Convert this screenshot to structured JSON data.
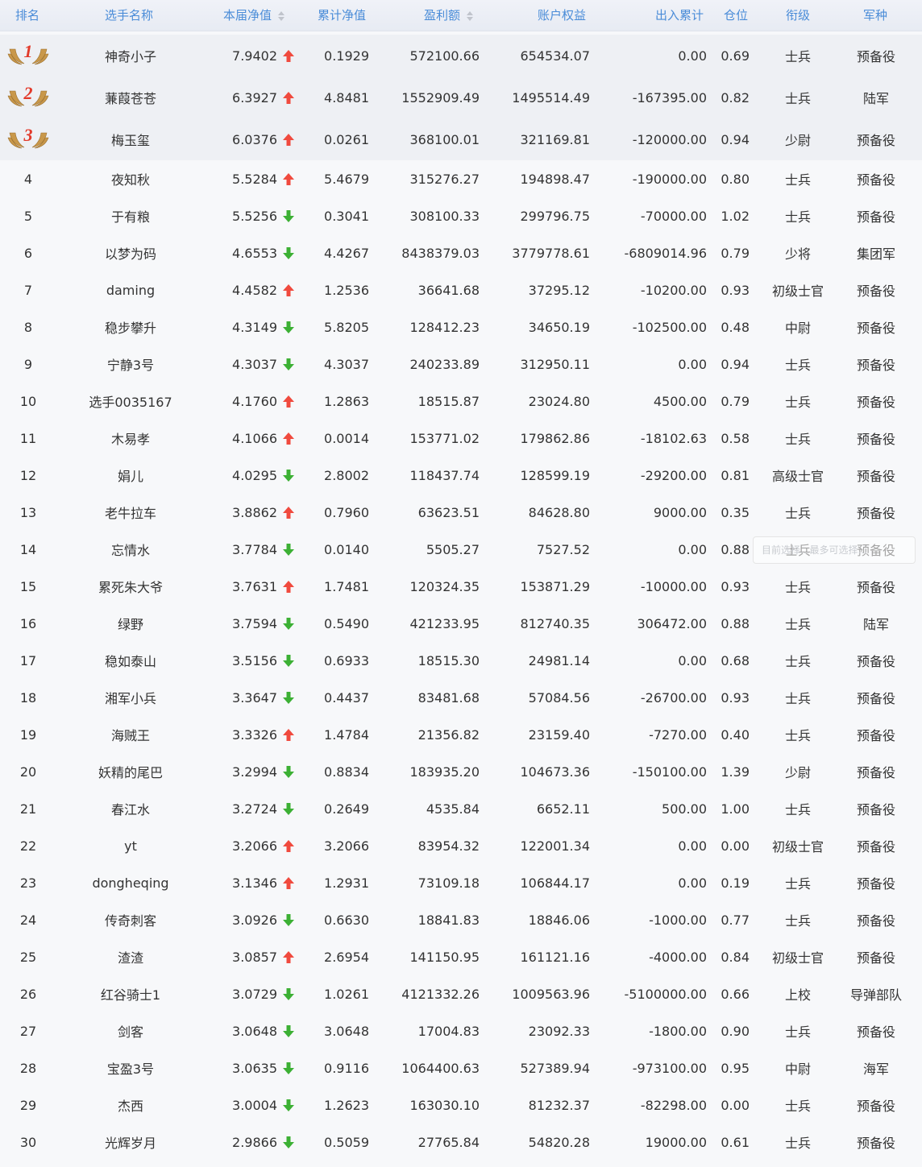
{
  "header": {
    "rank": "排名",
    "name": "选手名称",
    "nav": "本届净值",
    "cum_nav": "累计净值",
    "profit": "盈利额",
    "equity": "账户权益",
    "flow": "出入累计",
    "position": "仓位",
    "title": "衔级",
    "branch": "军种"
  },
  "colors": {
    "up": "#f04a3e",
    "down": "#3cb034",
    "header_text": "#4a8cd8"
  },
  "tooltip_text": "目前选择...最多可选择...",
  "rows": [
    {
      "rank": "1",
      "name": "神奇小子",
      "nav": "7.9402",
      "trend": "up",
      "cum": "0.1929",
      "profit": "572100.66",
      "equity": "654534.07",
      "flow": "0.00",
      "pos": "0.69",
      "title": "士兵",
      "branch": "预备役"
    },
    {
      "rank": "2",
      "name": "蒹葭苍苍",
      "nav": "6.3927",
      "trend": "up",
      "cum": "4.8481",
      "profit": "1552909.49",
      "equity": "1495514.49",
      "flow": "-167395.00",
      "pos": "0.82",
      "title": "士兵",
      "branch": "陆军"
    },
    {
      "rank": "3",
      "name": "梅玉玺",
      "nav": "6.0376",
      "trend": "up",
      "cum": "0.0261",
      "profit": "368100.01",
      "equity": "321169.81",
      "flow": "-120000.00",
      "pos": "0.94",
      "title": "少尉",
      "branch": "预备役"
    },
    {
      "rank": "4",
      "name": "夜知秋",
      "nav": "5.5284",
      "trend": "up",
      "cum": "5.4679",
      "profit": "315276.27",
      "equity": "194898.47",
      "flow": "-190000.00",
      "pos": "0.80",
      "title": "士兵",
      "branch": "预备役"
    },
    {
      "rank": "5",
      "name": "于有粮",
      "nav": "5.5256",
      "trend": "down",
      "cum": "0.3041",
      "profit": "308100.33",
      "equity": "299796.75",
      "flow": "-70000.00",
      "pos": "1.02",
      "title": "士兵",
      "branch": "预备役"
    },
    {
      "rank": "6",
      "name": "以梦为码",
      "nav": "4.6553",
      "trend": "down",
      "cum": "4.4267",
      "profit": "8438379.03",
      "equity": "3779778.61",
      "flow": "-6809014.96",
      "pos": "0.79",
      "title": "少将",
      "branch": "集团军"
    },
    {
      "rank": "7",
      "name": "daming",
      "nav": "4.4582",
      "trend": "up",
      "cum": "1.2536",
      "profit": "36641.68",
      "equity": "37295.12",
      "flow": "-10200.00",
      "pos": "0.93",
      "title": "初级士官",
      "branch": "预备役"
    },
    {
      "rank": "8",
      "name": "稳步攀升",
      "nav": "4.3149",
      "trend": "down",
      "cum": "5.8205",
      "profit": "128412.23",
      "equity": "34650.19",
      "flow": "-102500.00",
      "pos": "0.48",
      "title": "中尉",
      "branch": "预备役"
    },
    {
      "rank": "9",
      "name": "宁静3号",
      "nav": "4.3037",
      "trend": "down",
      "cum": "4.3037",
      "profit": "240233.89",
      "equity": "312950.11",
      "flow": "0.00",
      "pos": "0.94",
      "title": "士兵",
      "branch": "预备役"
    },
    {
      "rank": "10",
      "name": "选手0035167",
      "nav": "4.1760",
      "trend": "up",
      "cum": "1.2863",
      "profit": "18515.87",
      "equity": "23024.80",
      "flow": "4500.00",
      "pos": "0.79",
      "title": "士兵",
      "branch": "预备役"
    },
    {
      "rank": "11",
      "name": "木易孝",
      "nav": "4.1066",
      "trend": "up",
      "cum": "0.0014",
      "profit": "153771.02",
      "equity": "179862.86",
      "flow": "-18102.63",
      "pos": "0.58",
      "title": "士兵",
      "branch": "预备役"
    },
    {
      "rank": "12",
      "name": "娟儿",
      "nav": "4.0295",
      "trend": "down",
      "cum": "2.8002",
      "profit": "118437.74",
      "equity": "128599.19",
      "flow": "-29200.00",
      "pos": "0.81",
      "title": "高级士官",
      "branch": "预备役"
    },
    {
      "rank": "13",
      "name": "老牛拉车",
      "nav": "3.8862",
      "trend": "up",
      "cum": "0.7960",
      "profit": "63623.51",
      "equity": "84628.80",
      "flow": "9000.00",
      "pos": "0.35",
      "title": "士兵",
      "branch": "预备役"
    },
    {
      "rank": "14",
      "name": "忘情水",
      "nav": "3.7784",
      "trend": "down",
      "cum": "0.0140",
      "profit": "5505.27",
      "equity": "7527.52",
      "flow": "0.00",
      "pos": "0.88",
      "title": "士兵",
      "branch": "预备役"
    },
    {
      "rank": "15",
      "name": "累死朱大爷",
      "nav": "3.7631",
      "trend": "up",
      "cum": "1.7481",
      "profit": "120324.35",
      "equity": "153871.29",
      "flow": "-10000.00",
      "pos": "0.93",
      "title": "士兵",
      "branch": "预备役"
    },
    {
      "rank": "16",
      "name": "绿野",
      "nav": "3.7594",
      "trend": "down",
      "cum": "0.5490",
      "profit": "421233.95",
      "equity": "812740.35",
      "flow": "306472.00",
      "pos": "0.88",
      "title": "士兵",
      "branch": "陆军"
    },
    {
      "rank": "17",
      "name": "稳如泰山",
      "nav": "3.5156",
      "trend": "down",
      "cum": "0.6933",
      "profit": "18515.30",
      "equity": "24981.14",
      "flow": "0.00",
      "pos": "0.68",
      "title": "士兵",
      "branch": "预备役"
    },
    {
      "rank": "18",
      "name": "湘军小兵",
      "nav": "3.3647",
      "trend": "down",
      "cum": "0.4437",
      "profit": "83481.68",
      "equity": "57084.56",
      "flow": "-26700.00",
      "pos": "0.93",
      "title": "士兵",
      "branch": "预备役"
    },
    {
      "rank": "19",
      "name": "海贼王",
      "nav": "3.3326",
      "trend": "up",
      "cum": "1.4784",
      "profit": "21356.82",
      "equity": "23159.40",
      "flow": "-7270.00",
      "pos": "0.40",
      "title": "士兵",
      "branch": "预备役"
    },
    {
      "rank": "20",
      "name": "妖精的尾巴",
      "nav": "3.2994",
      "trend": "down",
      "cum": "0.8834",
      "profit": "183935.20",
      "equity": "104673.36",
      "flow": "-150100.00",
      "pos": "1.39",
      "title": "少尉",
      "branch": "预备役"
    },
    {
      "rank": "21",
      "name": "春江水",
      "nav": "3.2724",
      "trend": "down",
      "cum": "0.2649",
      "profit": "4535.84",
      "equity": "6652.11",
      "flow": "500.00",
      "pos": "1.00",
      "title": "士兵",
      "branch": "预备役"
    },
    {
      "rank": "22",
      "name": "yt",
      "nav": "3.2066",
      "trend": "up",
      "cum": "3.2066",
      "profit": "83954.32",
      "equity": "122001.34",
      "flow": "0.00",
      "pos": "0.00",
      "title": "初级士官",
      "branch": "预备役"
    },
    {
      "rank": "23",
      "name": "dongheqing",
      "nav": "3.1346",
      "trend": "up",
      "cum": "1.2931",
      "profit": "73109.18",
      "equity": "106844.17",
      "flow": "0.00",
      "pos": "0.19",
      "title": "士兵",
      "branch": "预备役"
    },
    {
      "rank": "24",
      "name": "传奇刺客",
      "nav": "3.0926",
      "trend": "down",
      "cum": "0.6630",
      "profit": "18841.83",
      "equity": "18846.06",
      "flow": "-1000.00",
      "pos": "0.77",
      "title": "士兵",
      "branch": "预备役"
    },
    {
      "rank": "25",
      "name": "渣渣",
      "nav": "3.0857",
      "trend": "up",
      "cum": "2.6954",
      "profit": "141150.95",
      "equity": "161121.16",
      "flow": "-4000.00",
      "pos": "0.84",
      "title": "初级士官",
      "branch": "预备役"
    },
    {
      "rank": "26",
      "name": "红谷骑士1",
      "nav": "3.0729",
      "trend": "down",
      "cum": "1.0261",
      "profit": "4121332.26",
      "equity": "1009563.96",
      "flow": "-5100000.00",
      "pos": "0.66",
      "title": "上校",
      "branch": "导弹部队"
    },
    {
      "rank": "27",
      "name": "剑客",
      "nav": "3.0648",
      "trend": "down",
      "cum": "3.0648",
      "profit": "17004.83",
      "equity": "23092.33",
      "flow": "-1800.00",
      "pos": "0.90",
      "title": "士兵",
      "branch": "预备役"
    },
    {
      "rank": "28",
      "name": "宝盈3号",
      "nav": "3.0635",
      "trend": "down",
      "cum": "0.9116",
      "profit": "1064400.63",
      "equity": "527389.94",
      "flow": "-973100.00",
      "pos": "0.95",
      "title": "中尉",
      "branch": "海军"
    },
    {
      "rank": "29",
      "name": "杰西",
      "nav": "3.0004",
      "trend": "down",
      "cum": "1.2623",
      "profit": "163030.10",
      "equity": "81232.37",
      "flow": "-82298.00",
      "pos": "0.00",
      "title": "士兵",
      "branch": "预备役"
    },
    {
      "rank": "30",
      "name": "光辉岁月",
      "nav": "2.9866",
      "trend": "down",
      "cum": "0.5059",
      "profit": "27765.84",
      "equity": "54820.28",
      "flow": "19000.00",
      "pos": "0.61",
      "title": "士兵",
      "branch": "预备役"
    }
  ]
}
